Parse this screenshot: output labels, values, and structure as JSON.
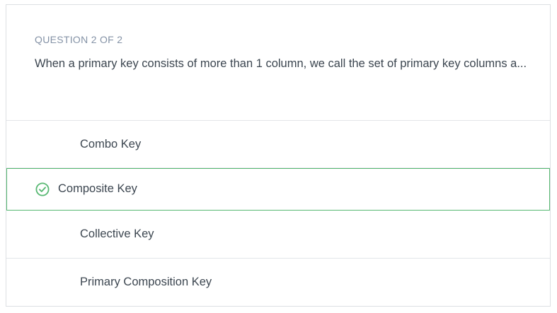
{
  "question": {
    "eyebrow": "QUESTION 2 OF 2",
    "prompt": "When a primary key consists of more than 1 column, we call the set of primary key columns a..."
  },
  "options": [
    {
      "label": "Combo Key",
      "selected": false
    },
    {
      "label": "Composite Key",
      "selected": true,
      "icon": "check-circle-icon"
    },
    {
      "label": "Collective Key",
      "selected": false
    },
    {
      "label": "Primary Composition Key",
      "selected": false
    }
  ],
  "colors": {
    "correct": "#57b872",
    "eyebrow": "#8492a6",
    "text": "#3c4650"
  }
}
